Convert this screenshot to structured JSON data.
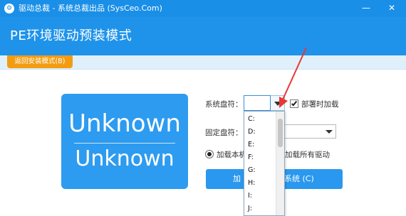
{
  "window": {
    "title": "驱动总裁  -  系统总裁出品 (SysCeo.Com)",
    "minimize_glyph": "—",
    "close_glyph": "✕"
  },
  "header": {
    "heading": "PE环境驱动预装模式",
    "back_button": "返回安装模式(B)"
  },
  "logo": {
    "line1": "Unknown",
    "line2": "Unknown"
  },
  "form": {
    "drive_label": "系统盘符：",
    "drive_value": "",
    "deploy_checkbox_label": "部署时加载",
    "deploy_checked": true,
    "fixed_drive_label": "固定盘符：",
    "fixed_drive_value": "",
    "radio_this_machine": "加载本机",
    "radio_all_label": "加载所有驱动",
    "install_button_left": "加",
    "install_button_right": "系统 (C)"
  },
  "dropdown": {
    "options": [
      "C:",
      "D:",
      "E:",
      "F:",
      "G:",
      "H:",
      "I:",
      "J:"
    ]
  },
  "colors": {
    "titlebar": "#1a8fe8",
    "header": "#1f93ea",
    "accent_orange": "#f39c12",
    "logo_panel": "#2d9bf0",
    "annotation_arrow": "#e53935"
  }
}
